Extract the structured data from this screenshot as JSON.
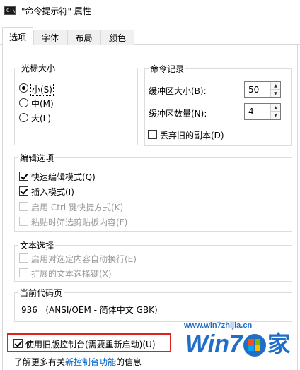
{
  "window": {
    "icon_text": "C:\\",
    "title": "\"命令提示符\" 属性"
  },
  "tabs": [
    {
      "label": "选项",
      "active": true
    },
    {
      "label": "字体",
      "active": false
    },
    {
      "label": "布局",
      "active": false
    },
    {
      "label": "颜色",
      "active": false
    }
  ],
  "cursor_size": {
    "legend": "光标大小",
    "options": [
      {
        "label": "小(S)",
        "checked": true
      },
      {
        "label": "中(M)",
        "checked": false
      },
      {
        "label": "大(L)",
        "checked": false
      }
    ]
  },
  "command_history": {
    "legend": "命令记录",
    "buffer_size_label": "缓冲区大小(B):",
    "buffer_size_value": "50",
    "buffer_count_label": "缓冲区数量(N):",
    "buffer_count_value": "4",
    "discard_label": "丢弃旧的副本(D)",
    "discard_checked": false
  },
  "edit_options": {
    "legend": "编辑选项",
    "items": [
      {
        "label": "快速编辑模式(Q)",
        "checked": true,
        "enabled": true
      },
      {
        "label": "插入模式(I)",
        "checked": true,
        "enabled": true
      },
      {
        "label": "启用 Ctrl 键快捷方式(K)",
        "checked": false,
        "enabled": false
      },
      {
        "label": "粘贴时筛选剪贴板内容(F)",
        "checked": false,
        "enabled": false
      }
    ]
  },
  "text_selection": {
    "legend": "文本选择",
    "items": [
      {
        "label": "启用对选定内容自动换行(E)",
        "checked": false,
        "enabled": false
      },
      {
        "label": "扩展的文本选择键(X)",
        "checked": false,
        "enabled": false
      }
    ]
  },
  "code_page": {
    "legend": "当前代码页",
    "value": "936   (ANSI/OEM - 简体中文 GBK)"
  },
  "legacy_console": {
    "label": "使用旧版控制台(需要重新启动)(U)",
    "checked": true
  },
  "footer": {
    "prefix": "了解更多有关",
    "link": "新控制台功能",
    "suffix": "的信息"
  },
  "watermark": {
    "url": "www.win7zhijia.cn",
    "brand": "Win7",
    "suffix": "家"
  },
  "colors": {
    "highlight_border": "#e0201b",
    "link": "#0066cc",
    "watermark_blue": "#1f6fc9"
  }
}
